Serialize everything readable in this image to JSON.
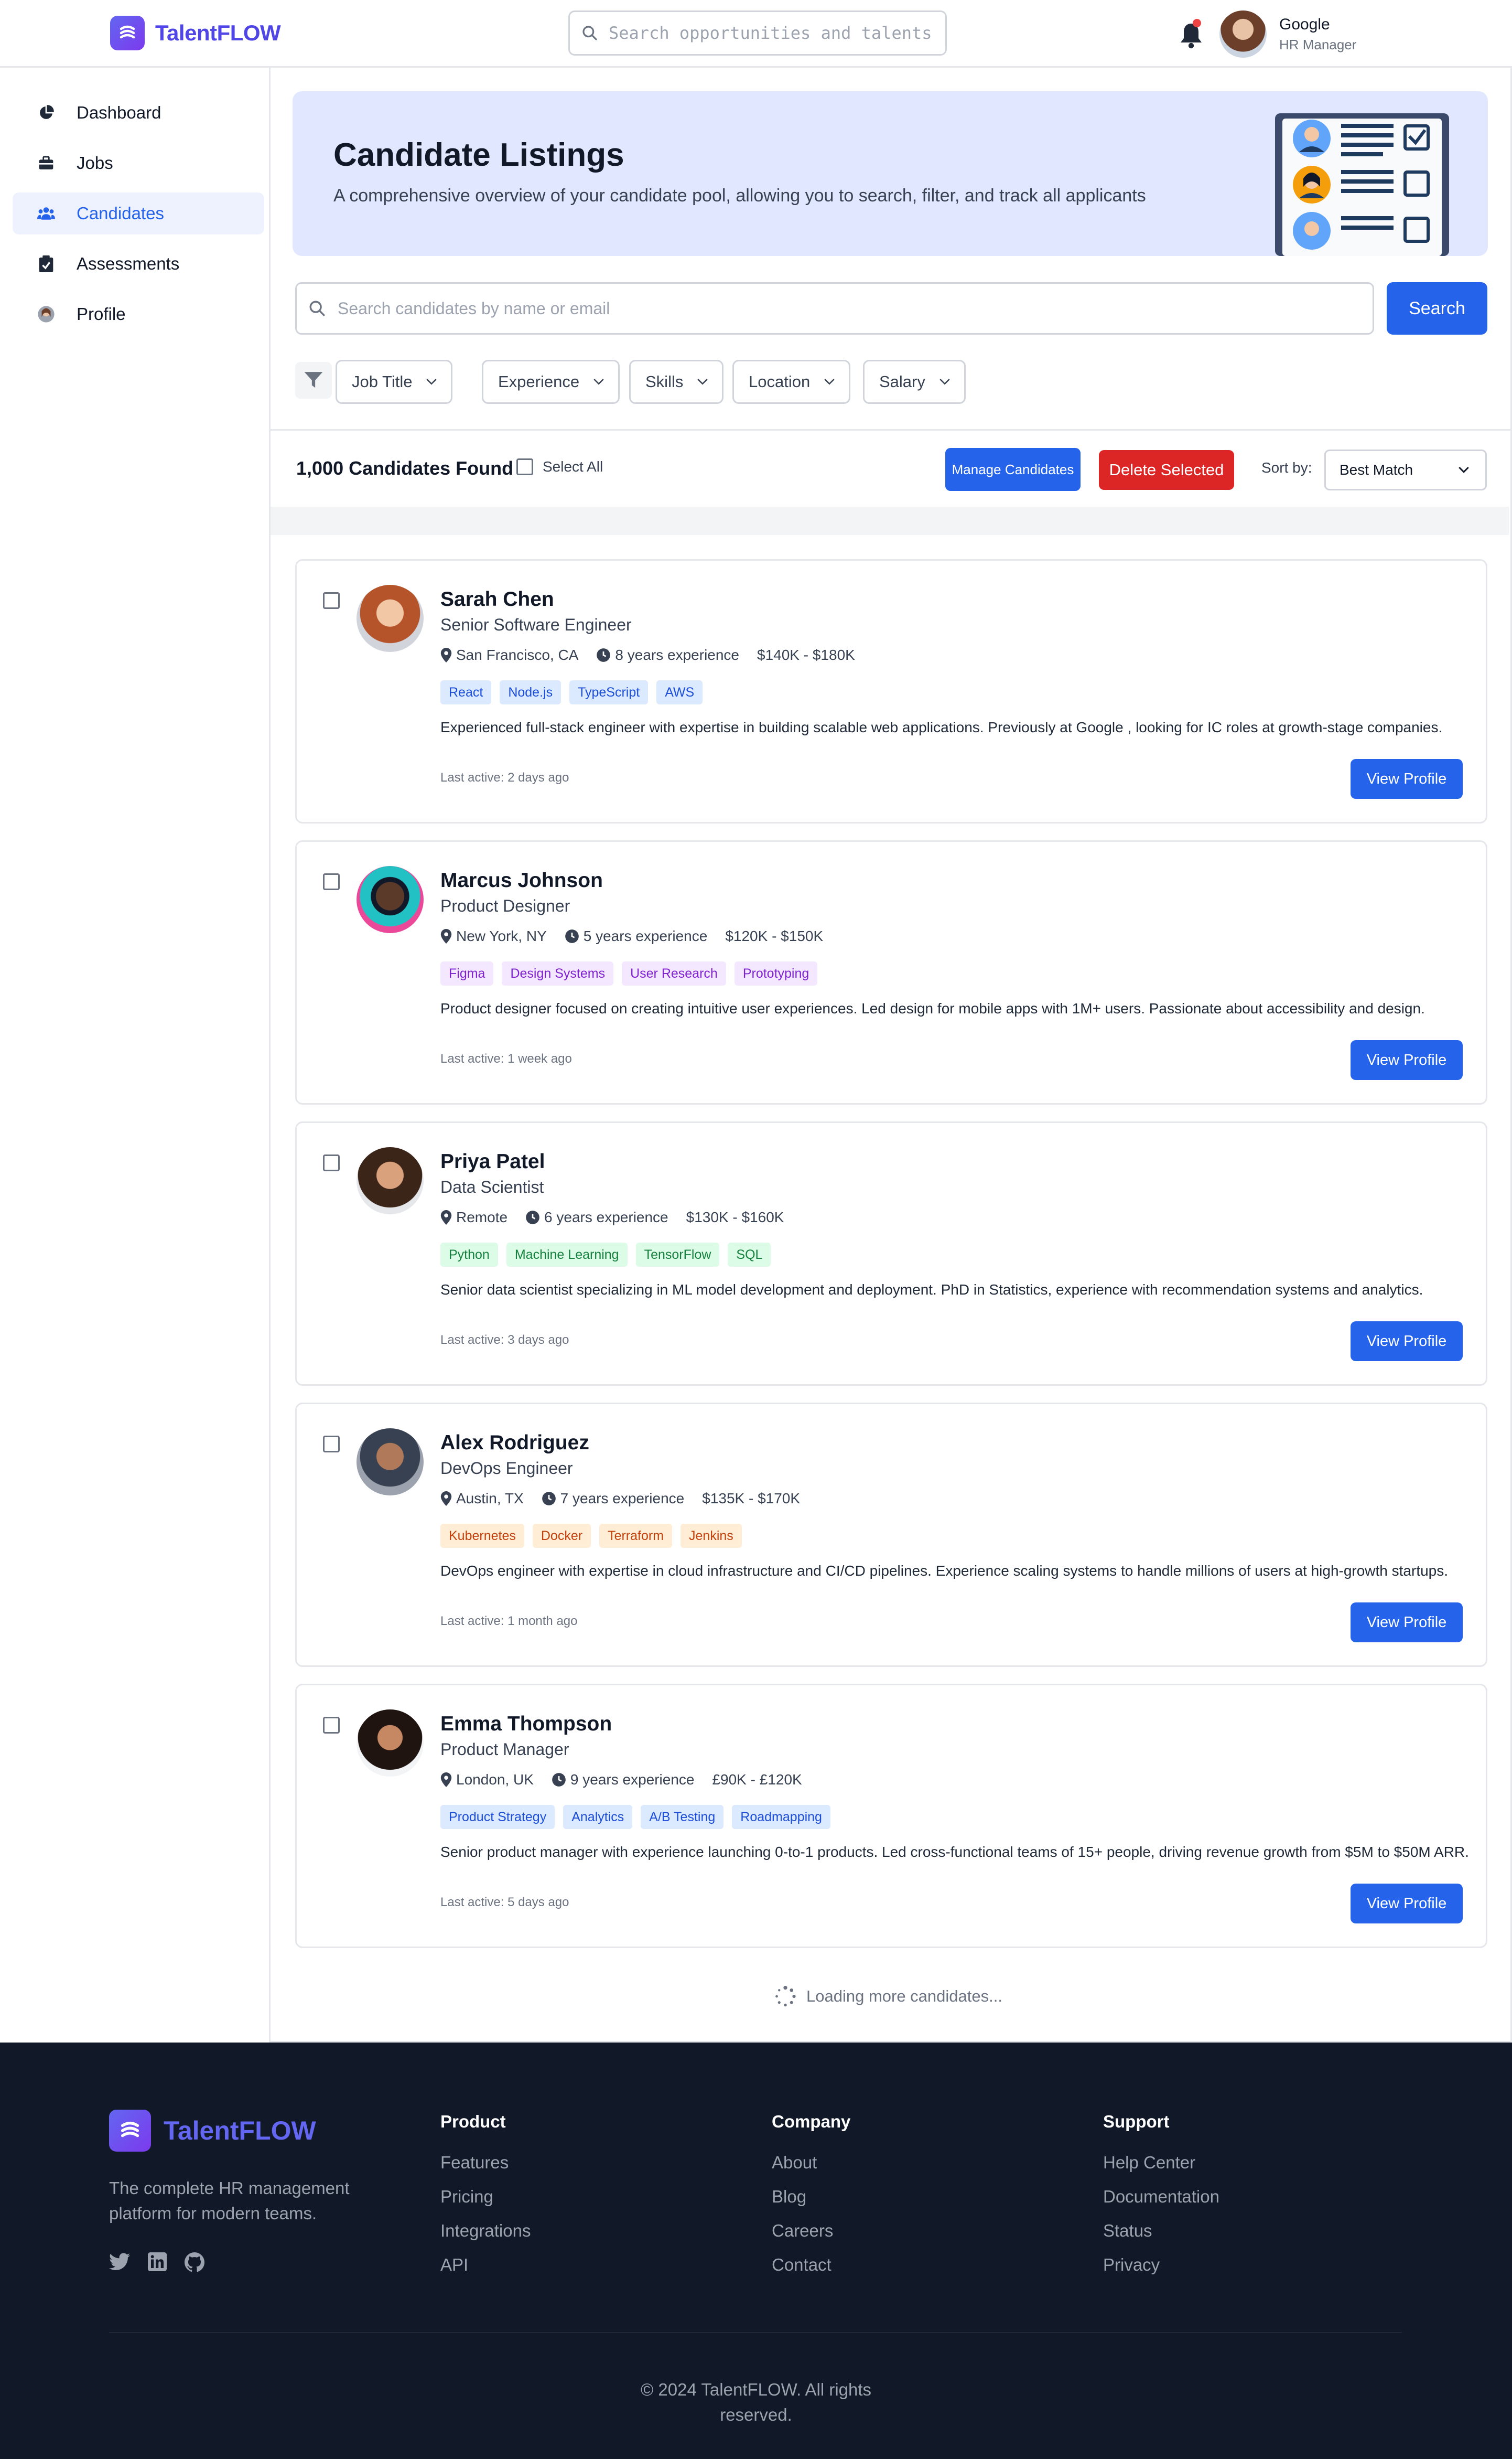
{
  "header": {
    "brand": "TalentFLOW",
    "search_placeholder": "Search opportunities and talents",
    "user_name": "Google",
    "user_role": "HR Manager"
  },
  "sidebar": {
    "items": [
      {
        "label": "Dashboard",
        "icon": "pie-chart-icon"
      },
      {
        "label": "Jobs",
        "icon": "briefcase-icon"
      },
      {
        "label": "Candidates",
        "icon": "users-icon",
        "active": true
      },
      {
        "label": "Assessments",
        "icon": "clipboard-check-icon"
      },
      {
        "label": "Profile",
        "icon": "avatar-icon"
      }
    ]
  },
  "banner": {
    "title": "Candidate Listings",
    "subtitle": "A comprehensive overview of your candidate pool, allowing you to search, filter, and track all applicants"
  },
  "search": {
    "placeholder": "Search candidates by name or email",
    "button": "Search"
  },
  "filters": [
    "Job Title",
    "Experience",
    "Skills",
    "Location",
    "Salary"
  ],
  "toolbar": {
    "count": "1,000 Candidates Found",
    "select_all": "Select All",
    "manage": "Manage Candidates",
    "delete": "Delete Selected",
    "sort_label": "Sort by:",
    "sort_value": "Best Match"
  },
  "candidates": [
    {
      "name": "Sarah Chen",
      "role": "Senior Software Engineer",
      "location": "San Francisco, CA",
      "experience": "8 years experience",
      "salary": "$140K - $180K",
      "tags": [
        "React",
        "Node.js",
        "TypeScript",
        "AWS"
      ],
      "tag_color": "blue",
      "description": "Experienced full-stack engineer with expertise in building scalable web applications. Previously at Google , looking for  IC roles at growth-stage companies.",
      "last_active": "Last active: 2 days ago",
      "cta": "View Profile"
    },
    {
      "name": "Marcus Johnson",
      "role": "Product Designer",
      "location": "New York, NY",
      "experience": "5 years experience",
      "salary": "$120K - $150K",
      "tags": [
        "Figma",
        "Design Systems",
        "User Research",
        "Prototyping"
      ],
      "tag_color": "purple",
      "description": "Product designer focused on creating intuitive user experiences. Led design for mobile apps with 1M+ users. Passionate about accessibility and  design.",
      "last_active": "Last active: 1 week ago",
      "cta": "View Profile"
    },
    {
      "name": "Priya Patel",
      "role": "Data Scientist",
      "location": "Remote",
      "experience": "6 years experience",
      "salary": "$130K - $160K",
      "tags": [
        "Python",
        "Machine Learning",
        "TensorFlow",
        "SQL"
      ],
      "tag_color": "green",
      "description": "Senior data scientist specializing in ML model development and deployment. PhD in Statistics, experience with recommendation systems and analytics.",
      "last_active": "Last active: 3 days ago",
      "cta": "View Profile"
    },
    {
      "name": "Alex Rodriguez",
      "role": "DevOps Engineer",
      "location": "Austin, TX",
      "experience": "7 years experience",
      "salary": "$135K - $170K",
      "tags": [
        "Kubernetes",
        "Docker",
        "Terraform",
        "Jenkins"
      ],
      "tag_color": "orange",
      "description": "DevOps engineer with expertise in cloud infrastructure and CI/CD pipelines. Experience scaling systems to handle millions of users at high-growth startups.",
      "last_active": "Last active: 1 month ago",
      "cta": "View Profile"
    },
    {
      "name": "Emma Thompson",
      "role": "Product Manager",
      "location": "London, UK",
      "experience": "9 years experience",
      "salary": "£90K - £120K",
      "tags": [
        "Product Strategy",
        "Analytics",
        "A/B Testing",
        "Roadmapping"
      ],
      "tag_color": "blue",
      "description": "Senior product manager with experience launching 0-to-1 products. Led cross-functional teams of 15+ people, driving revenue growth from $5M to $50M ARR.",
      "last_active": "Last active: 5 days ago",
      "cta": "View Profile"
    }
  ],
  "loading_text": "Loading more candidates...",
  "footer": {
    "brand": "TalentFLOW",
    "tagline": "The complete HR management platform for modern teams.",
    "columns": [
      {
        "title": "Product",
        "links": [
          "Features",
          "Pricing",
          "Integrations",
          "API"
        ]
      },
      {
        "title": "Company",
        "links": [
          "About",
          "Blog",
          "Careers",
          "Contact"
        ]
      },
      {
        "title": "Support",
        "links": [
          "Help Center",
          "Documentation",
          "Status",
          "Privacy"
        ]
      }
    ],
    "copyright": "© 2024 TalentFLOW. All rights reserved."
  },
  "colors": {
    "accent": "#2563eb",
    "brand": "#4f46e5",
    "danger": "#dc2626",
    "banner_bg": "#e0e7ff",
    "footer_bg": "#111827"
  }
}
